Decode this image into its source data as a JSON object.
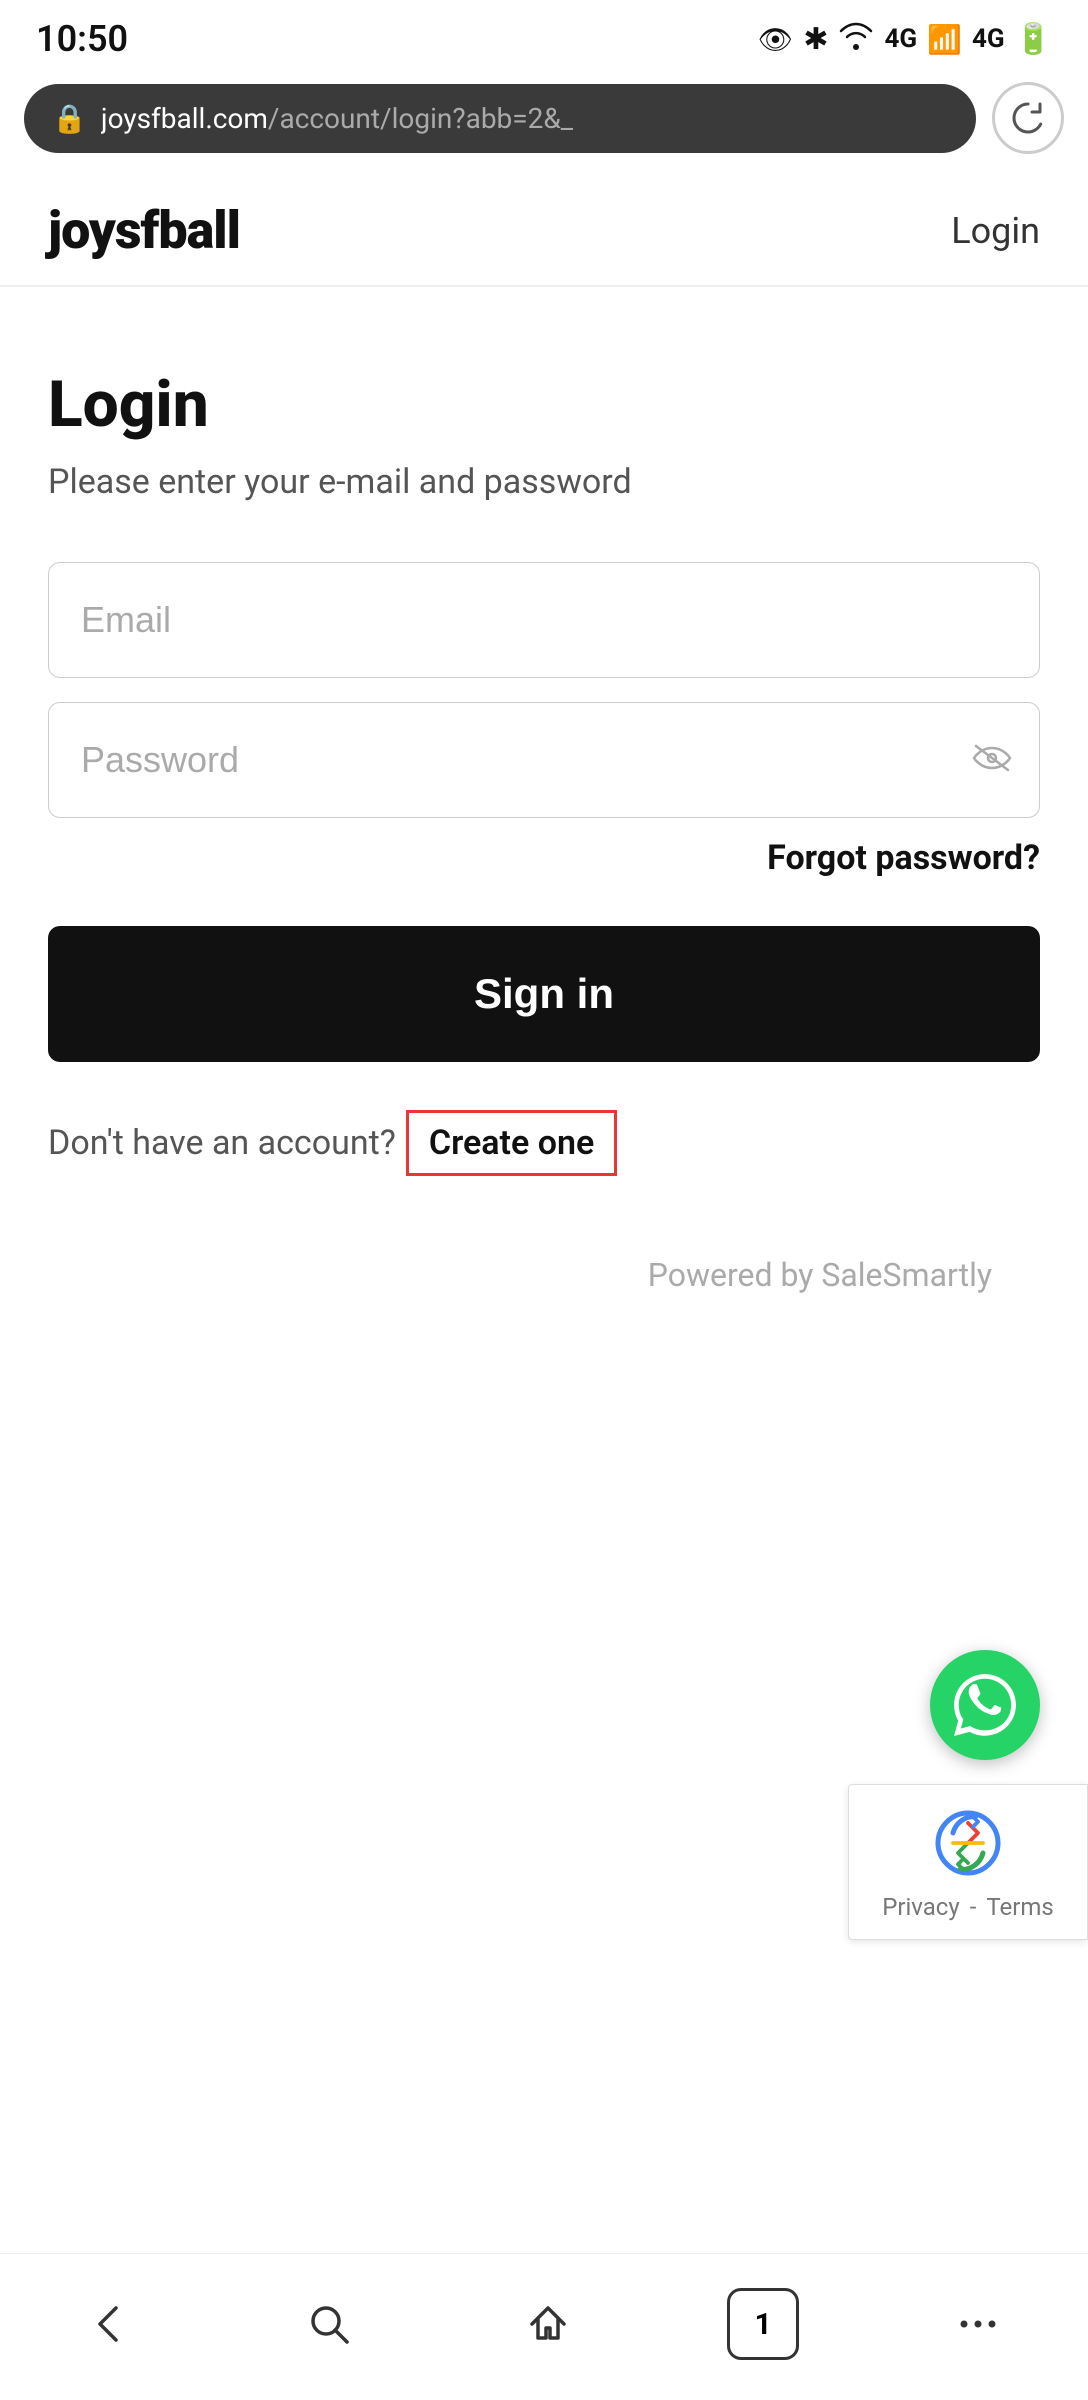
{
  "status_bar": {
    "time": "10:50"
  },
  "address_bar": {
    "domain": "joysfball.com",
    "path": "/account/login?abb=2&_"
  },
  "site_header": {
    "logo": "joysfball",
    "login_link": "Login"
  },
  "login_page": {
    "title": "Login",
    "subtitle": "Please enter your e-mail and password",
    "email_placeholder": "Email",
    "password_placeholder": "Password",
    "forgot_password": "Forgot password?",
    "sign_in_button": "Sign in",
    "no_account_text": "Don't have an account?",
    "create_one_text": "Create one"
  },
  "powered_by": {
    "text": "Powered by SaleSmartly"
  },
  "recaptcha": {
    "privacy": "Privacy",
    "dash": "-",
    "terms": "Terms"
  },
  "bottom_nav": {
    "tab_number": "1"
  }
}
